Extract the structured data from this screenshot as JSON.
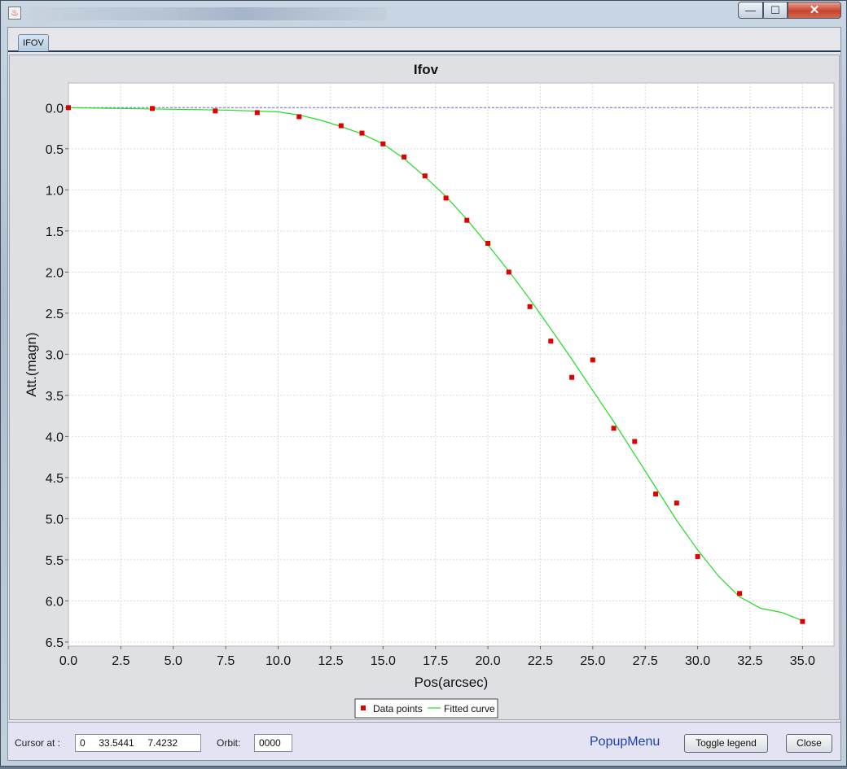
{
  "window": {
    "title": "",
    "buttons": {
      "minimize": "—",
      "maximize": "☐",
      "close": "✕"
    }
  },
  "tabs": [
    {
      "label": "IFOV",
      "selected": true
    }
  ],
  "chart_data": {
    "type": "scatter",
    "title": "Ifov",
    "xlabel": "Pos(arcsec)",
    "ylabel": "Att.(magn)",
    "xlim": [
      0,
      36.5
    ],
    "ylim": [
      6.55,
      -0.3
    ],
    "y_inverted": true,
    "xticks": [
      0,
      2.5,
      5,
      7.5,
      10,
      12.5,
      15,
      17.5,
      20,
      22.5,
      25,
      27.5,
      30,
      32.5,
      35
    ],
    "xtick_labels": [
      "0.0",
      "2.5",
      "5.0",
      "7.5",
      "10.0",
      "12.5",
      "15.0",
      "17.5",
      "20.0",
      "22.5",
      "25.0",
      "27.5",
      "30.0",
      "32.5",
      "35.0"
    ],
    "yticks": [
      0,
      0.5,
      1,
      1.5,
      2,
      2.5,
      3,
      3.5,
      4,
      4.5,
      5,
      5.5,
      6,
      6.5
    ],
    "ytick_labels": [
      "0.0",
      "0.5",
      "1.0",
      "1.5",
      "2.0",
      "2.5",
      "3.0",
      "3.5",
      "4.0",
      "4.5",
      "5.0",
      "5.5",
      "6.0",
      "6.5"
    ],
    "grid": true,
    "legend_position": "bottom-center",
    "series": [
      {
        "name": "Data points",
        "kind": "points",
        "color": "#e00000",
        "x": [
          0,
          4,
          7,
          9,
          11,
          13,
          14,
          15,
          16,
          17,
          18,
          19,
          20,
          21,
          22,
          23,
          24,
          25,
          26,
          27,
          28,
          29,
          30,
          32,
          35
        ],
        "y": [
          0.0,
          0.01,
          0.04,
          0.06,
          0.11,
          0.22,
          0.31,
          0.44,
          0.6,
          0.83,
          1.1,
          1.37,
          1.65,
          2.0,
          2.42,
          2.84,
          3.28,
          3.07,
          3.9,
          4.06,
          4.7,
          4.81,
          5.46,
          5.91,
          6.25
        ]
      },
      {
        "name": "Fitted curve",
        "kind": "line",
        "color": "#22dd22",
        "x": [
          0,
          2.5,
          5,
          7.5,
          10,
          11,
          12,
          13,
          14,
          15,
          16,
          17,
          18,
          19,
          20,
          21,
          22,
          23,
          24,
          25,
          26,
          27,
          28,
          29,
          30,
          31,
          32,
          33,
          34,
          35
        ],
        "y": [
          0,
          0.01,
          0.02,
          0.03,
          0.05,
          0.09,
          0.15,
          0.23,
          0.32,
          0.44,
          0.62,
          0.84,
          1.08,
          1.36,
          1.67,
          1.99,
          2.33,
          2.69,
          3.06,
          3.44,
          3.82,
          4.22,
          4.62,
          5.02,
          5.38,
          5.7,
          5.95,
          6.09,
          6.14,
          6.24
        ]
      }
    ],
    "reference_line": {
      "y": 0,
      "color": "#6b6bd6"
    }
  },
  "status": {
    "cursor_label": "Cursor at :",
    "cursor_value": "0     33.5441     7.4232",
    "orbit_label": "Orbit:",
    "orbit_value": "0000",
    "popup_label": "PopupMenu",
    "toggle_label": "Toggle legend",
    "close_label": "Close"
  }
}
